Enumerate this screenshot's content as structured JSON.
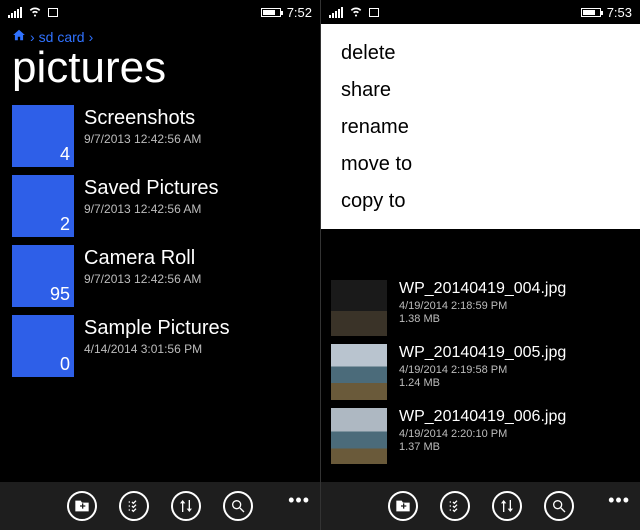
{
  "left": {
    "status": {
      "time": "7:52"
    },
    "breadcrumb": {
      "crumb1": "sd card"
    },
    "title": "pictures",
    "folders": [
      {
        "name": "Screenshots",
        "date": "9/7/2013 12:42:56 AM",
        "count": "4"
      },
      {
        "name": "Saved Pictures",
        "date": "9/7/2013 12:42:56 AM",
        "count": "2"
      },
      {
        "name": "Camera Roll",
        "date": "9/7/2013 12:42:56 AM",
        "count": "95"
      },
      {
        "name": "Sample Pictures",
        "date": "4/14/2014 3:01:56 PM",
        "count": "0"
      }
    ]
  },
  "right": {
    "status": {
      "time": "7:53"
    },
    "menu": {
      "delete": "delete",
      "share": "share",
      "rename": "rename",
      "moveto": "move to",
      "copyto": "copy to"
    },
    "files": [
      {
        "name": "WP_20140419_004.jpg",
        "date": "4/19/2014 2:18:59 PM",
        "size": "1.38 MB"
      },
      {
        "name": "WP_20140419_005.jpg",
        "date": "4/19/2014 2:19:58 PM",
        "size": "1.24 MB"
      },
      {
        "name": "WP_20140419_006.jpg",
        "date": "4/19/2014 2:20:10 PM",
        "size": "1.37 MB"
      }
    ]
  },
  "icons": {
    "newfolder": "new-folder",
    "select": "select",
    "sort": "sort",
    "search": "search"
  }
}
